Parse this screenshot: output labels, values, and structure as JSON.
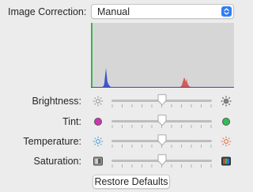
{
  "image_correction": {
    "label": "Image Correction:",
    "selected": "Manual",
    "stepper_icon": "up-down-chevron-icon",
    "accent_color": "#2f7ef6"
  },
  "histogram": {
    "background": "#d6d6d6",
    "channels": [
      "red",
      "green",
      "blue"
    ],
    "colors": {
      "red": "#d34c4c",
      "green": "#3ab54a",
      "blue": "#3048c8"
    }
  },
  "sliders": [
    {
      "label": "Brightness:",
      "value": 0.5,
      "left_icon": "sun-dim-icon",
      "right_icon": "sun-bright-icon"
    },
    {
      "label": "Tint:",
      "value": 0.5,
      "left_icon": "magenta-dot-icon",
      "right_icon": "green-dot-icon"
    },
    {
      "label": "Temperature:",
      "value": 0.5,
      "left_icon": "sun-cool-icon",
      "right_icon": "sun-warm-icon"
    },
    {
      "label": "Saturation:",
      "value": 0.5,
      "left_icon": "grayscale-icon",
      "right_icon": "color-bars-icon"
    }
  ],
  "restore_button": {
    "label": "Restore Defaults"
  }
}
